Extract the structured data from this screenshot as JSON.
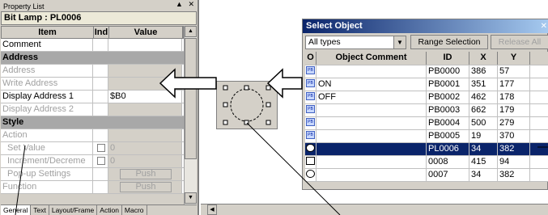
{
  "property_list": {
    "title": "Property List",
    "window_controls": "▲ ✕",
    "object_name": "Bit Lamp : PL0006",
    "columns": {
      "item": "Item",
      "ind": "Ind",
      "value": "Value"
    },
    "rows": [
      {
        "kind": "normal",
        "item": "Comment",
        "value": ""
      },
      {
        "kind": "section",
        "item": "Address"
      },
      {
        "kind": "disabled",
        "item": "Address",
        "value": ""
      },
      {
        "kind": "disabled",
        "item": "Write Address",
        "value": ""
      },
      {
        "kind": "normal",
        "item": "Display Address 1",
        "value": "$B0"
      },
      {
        "kind": "disabled",
        "item": "Display Address 2",
        "value": ""
      },
      {
        "kind": "section",
        "item": "Style"
      },
      {
        "kind": "disabled",
        "item": "Action",
        "value": ""
      },
      {
        "kind": "disabled",
        "item": "Set Value",
        "value": "0"
      },
      {
        "kind": "disabled",
        "item": "Increment/Decreme",
        "value": "0"
      },
      {
        "kind": "disabled",
        "item": "Pop-up Settings",
        "value": "Push"
      },
      {
        "kind": "disabled",
        "item": "Function",
        "value": "Push"
      }
    ],
    "tabs": [
      "General",
      "Text",
      "Layout/Frame",
      "Action",
      "Macro"
    ]
  },
  "select_object": {
    "title": "Select Object",
    "close_glyph": "✕",
    "type_filter": "All types",
    "range_selection": "Range Selection",
    "release_all": "Release All",
    "columns": {
      "o": "O",
      "comment": "Object Comment",
      "id": "ID",
      "x": "X",
      "y": "Y"
    },
    "rows": [
      {
        "icon": "pb",
        "comment": "",
        "id": "PB0000",
        "x": "386",
        "y": "57",
        "selected": false
      },
      {
        "icon": "pb",
        "comment": "ON",
        "id": "PB0001",
        "x": "351",
        "y": "177",
        "selected": false
      },
      {
        "icon": "pb",
        "comment": "OFF",
        "id": "PB0002",
        "x": "462",
        "y": "178",
        "selected": false
      },
      {
        "icon": "pb",
        "comment": "",
        "id": "PB0003",
        "x": "662",
        "y": "179",
        "selected": false
      },
      {
        "icon": "pb",
        "comment": "",
        "id": "PB0004",
        "x": "500",
        "y": "279",
        "selected": false
      },
      {
        "icon": "pb",
        "comment": "",
        "id": "PB0005",
        "x": "19",
        "y": "370",
        "selected": false
      },
      {
        "icon": "lamp",
        "comment": "",
        "id": "PL0006",
        "x": "34",
        "y": "382",
        "selected": true
      },
      {
        "icon": "square",
        "comment": "",
        "id": "0008",
        "x": "415",
        "y": "94",
        "selected": false
      },
      {
        "icon": "circle",
        "comment": "",
        "id": "0007",
        "x": "34",
        "y": "382",
        "selected": false
      }
    ]
  },
  "colors": {
    "title_bar": "#0a246a",
    "selection": "#0a246a",
    "face": "#d4d0c8",
    "section": "#a8a8a8"
  }
}
